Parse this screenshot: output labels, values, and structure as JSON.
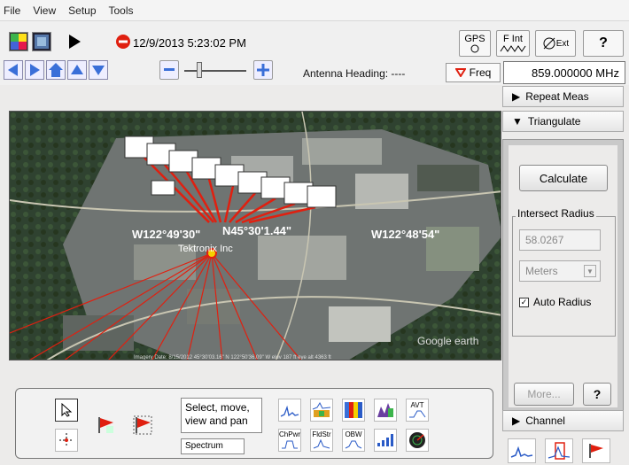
{
  "menu": [
    "File",
    "View",
    "Setup",
    "Tools"
  ],
  "toolbar": {
    "datetime": "12/9/2013 5:23:02 PM",
    "antenna_heading": "Antenna Heading: ----",
    "freq_label": "Freq",
    "freq_value": "859.000000 MHz",
    "gps": "GPS",
    "fint": "F Int",
    "ext": "Ext",
    "help": "?"
  },
  "map": {
    "coord_left": "W122°49'30\"",
    "coord_center": "N45°30'1.44\"",
    "coord_right": "W122°48'54\"",
    "place": "Tektronix Inc",
    "attribution": "Imagery Date: 8/15/2012   45°30'03.16\" N  122°50'36.09\" W  elev 187 ft   eye alt 4363 ft",
    "brand": "Google earth"
  },
  "right_panel": {
    "repeat_meas": "Repeat Meas",
    "triangulate": "Triangulate",
    "calculate": "Calculate",
    "intersect_radius": "Intersect Radius",
    "radius_value": "58.0267",
    "units": "Meters",
    "auto_radius": "Auto Radius",
    "more": "More...",
    "help": "?",
    "channel": "Channel"
  },
  "bottom": {
    "select_tooltip": "Select, move, view and pan",
    "spectrum": "Spectrum",
    "chpwr": "ChPwr",
    "fldstr": "FldStr",
    "obw": "OBW",
    "avt": "AVT"
  },
  "colors": {
    "arrow_red": "#e02010",
    "map_bg": "#2d3d2a"
  }
}
